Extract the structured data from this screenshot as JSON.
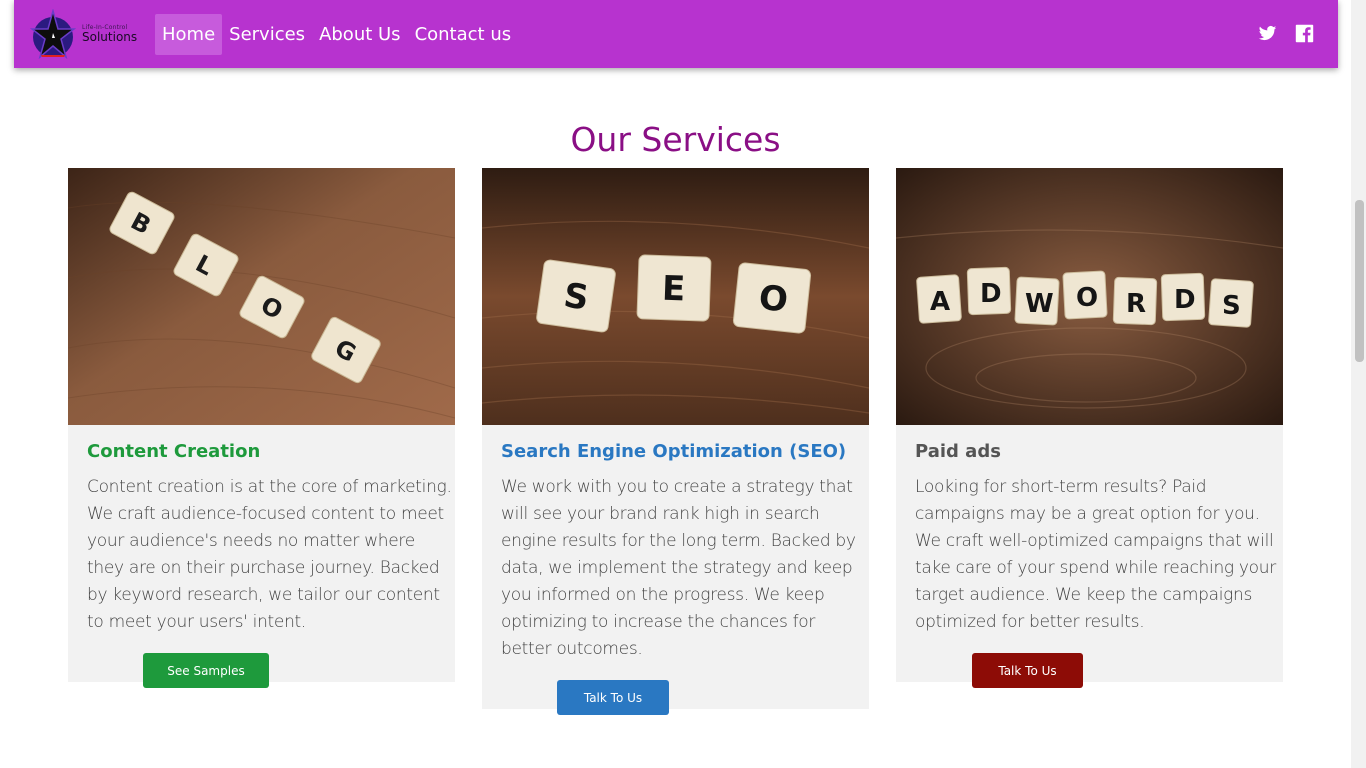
{
  "brand": {
    "tagline": "Life-In-Control",
    "name": "Solutions"
  },
  "nav": {
    "items": [
      {
        "label": "Home",
        "active": true
      },
      {
        "label": "Services",
        "active": false
      },
      {
        "label": "About Us",
        "active": false
      },
      {
        "label": "Contact us",
        "active": false
      }
    ],
    "social": [
      {
        "icon": "twitter-icon"
      },
      {
        "icon": "facebook-icon"
      }
    ]
  },
  "section": {
    "title": "Our Services"
  },
  "cards": [
    {
      "image_tiles": [
        "B",
        "L",
        "O",
        "G"
      ],
      "title": "Content Creation",
      "text": "Content creation is at the core of marketing. We craft audience-focused content to meet your audience's needs no matter where they are on their purchase journey. Backed by keyword research, we tailor our content to meet your users' intent.",
      "button": "See Samples",
      "color": "#1e9a3c"
    },
    {
      "image_tiles": [
        "S",
        "E",
        "O"
      ],
      "title": "Search Engine Optimization (SEO)",
      "text": "We work with you to create a strategy that will see your brand rank high in search engine results for the long term. Backed by data, we implement the strategy and keep you informed on the progress. We keep optimizing to increase the chances for better outcomes.",
      "button": "Talk To Us",
      "color": "#2a78c2"
    },
    {
      "image_tiles": [
        "A",
        "D",
        "W",
        "O",
        "R",
        "D",
        "S"
      ],
      "title": "Paid ads",
      "text": "Looking for short-term results? Paid campaigns may be a great option for you. We craft well-optimized campaigns that will take care of your spend while reaching your target audience. We keep the campaigns optimized for better results.",
      "button": "Talk To Us",
      "color": "#8d0c06"
    }
  ],
  "colors": {
    "navbar": "#b733cf",
    "heading": "#8a0f85"
  }
}
